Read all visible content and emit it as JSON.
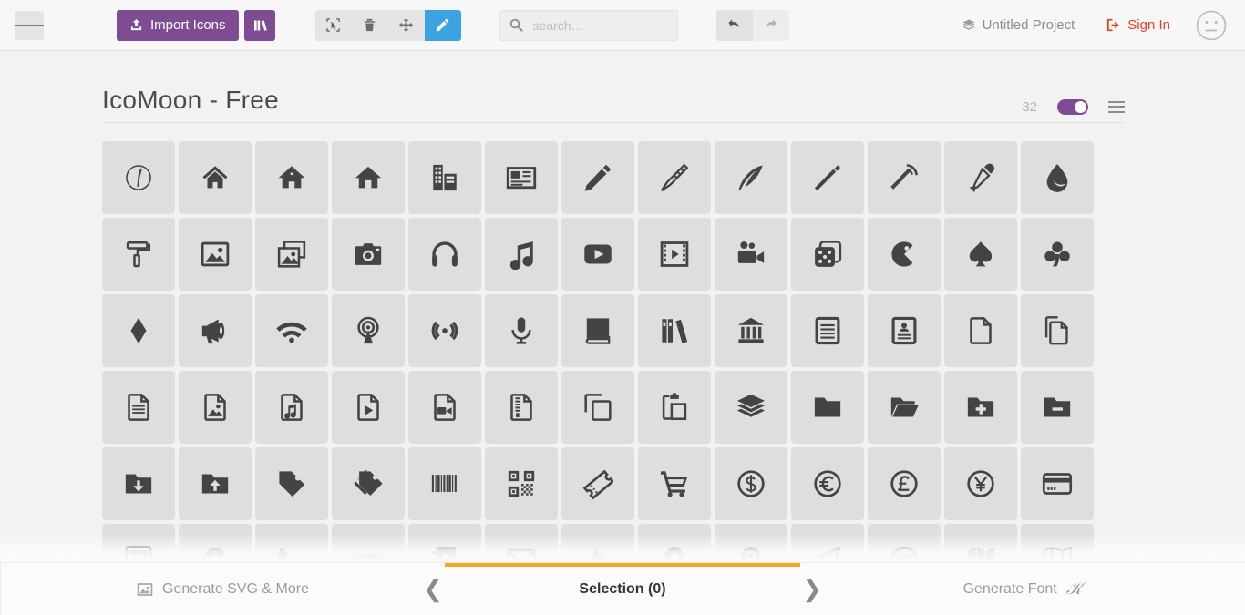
{
  "toolbar": {
    "menu_icon": "hamburger-icon",
    "import_label": "Import Icons",
    "import_icon": "upload-icon",
    "library_icon": "library-icon",
    "tools": [
      {
        "name": "select-tool",
        "icon": "cursor-select-icon",
        "active": false
      },
      {
        "name": "delete-tool",
        "icon": "trash-icon",
        "active": false
      },
      {
        "name": "move-tool",
        "icon": "move-arrows-icon",
        "active": false
      },
      {
        "name": "edit-tool",
        "icon": "pencil-icon",
        "active": true
      }
    ],
    "search": {
      "value": "",
      "placeholder": "search…",
      "icon": "search-icon"
    },
    "undo_icon": "undo-arrow-icon",
    "redo_icon": "redo-arrow-icon",
    "project_label": "Untitled Project",
    "project_icon": "layers-icon",
    "signin_label": "Sign In",
    "signin_icon": "login-icon",
    "avatar_icon": "neutral-face-icon",
    "accent_purple": "#7e4c93",
    "accent_blue": "#3ba3e0",
    "accent_red": "#e8402a"
  },
  "set": {
    "title": "IcoMoon - Free",
    "count": "32",
    "toggle_on": true,
    "toggle_color": "#7e4c93",
    "menu_icon": "set-menu-icon"
  },
  "icons": [
    {
      "name": "icomoon-logo-icon"
    },
    {
      "name": "home-outline-icon"
    },
    {
      "name": "home-2-icon"
    },
    {
      "name": "home-3-icon"
    },
    {
      "name": "office-icon"
    },
    {
      "name": "newspaper-icon"
    },
    {
      "name": "pencil-icon"
    },
    {
      "name": "pencil-2-icon"
    },
    {
      "name": "quill-icon"
    },
    {
      "name": "pen-icon"
    },
    {
      "name": "blog-icon"
    },
    {
      "name": "eyedropper-icon"
    },
    {
      "name": "droplet-icon"
    },
    {
      "name": "paint-format-icon"
    },
    {
      "name": "image-icon"
    },
    {
      "name": "images-icon"
    },
    {
      "name": "camera-icon"
    },
    {
      "name": "headphones-icon"
    },
    {
      "name": "music-icon"
    },
    {
      "name": "play-icon"
    },
    {
      "name": "film-icon"
    },
    {
      "name": "video-camera-icon"
    },
    {
      "name": "dice-icon"
    },
    {
      "name": "pacman-icon"
    },
    {
      "name": "spades-icon"
    },
    {
      "name": "clubs-icon"
    },
    {
      "name": "diamonds-icon"
    },
    {
      "name": "bullhorn-icon"
    },
    {
      "name": "connection-icon"
    },
    {
      "name": "podcast-icon"
    },
    {
      "name": "feed-icon"
    },
    {
      "name": "mic-icon"
    },
    {
      "name": "book-icon"
    },
    {
      "name": "books-icon"
    },
    {
      "name": "library-icon"
    },
    {
      "name": "file-text-icon"
    },
    {
      "name": "profile-icon"
    },
    {
      "name": "file-empty-icon"
    },
    {
      "name": "files-empty-icon"
    },
    {
      "name": "file-text2-icon"
    },
    {
      "name": "file-picture-icon"
    },
    {
      "name": "file-music-icon"
    },
    {
      "name": "file-play-icon"
    },
    {
      "name": "file-video-icon"
    },
    {
      "name": "file-zip-icon"
    },
    {
      "name": "copy-icon"
    },
    {
      "name": "paste-icon"
    },
    {
      "name": "stack-icon"
    },
    {
      "name": "folder-icon"
    },
    {
      "name": "folder-open-icon"
    },
    {
      "name": "folder-plus-icon"
    },
    {
      "name": "folder-minus-icon"
    },
    {
      "name": "folder-download-icon"
    },
    {
      "name": "folder-upload-icon"
    },
    {
      "name": "price-tag-icon"
    },
    {
      "name": "price-tags-icon"
    },
    {
      "name": "barcode-icon"
    },
    {
      "name": "qrcode-icon"
    },
    {
      "name": "ticket-icon"
    },
    {
      "name": "cart-icon"
    },
    {
      "name": "coin-dollar-icon"
    },
    {
      "name": "coin-euro-icon"
    },
    {
      "name": "coin-pound-icon"
    },
    {
      "name": "coin-yen-icon"
    },
    {
      "name": "credit-card-icon"
    },
    {
      "name": "calculator-icon"
    },
    {
      "name": "lifebuoy-icon"
    },
    {
      "name": "phone-icon"
    },
    {
      "name": "phone-hang-up-icon"
    },
    {
      "name": "address-book-icon"
    },
    {
      "name": "envelop-icon"
    },
    {
      "name": "pushpin-icon"
    },
    {
      "name": "location-icon"
    },
    {
      "name": "location2-icon"
    },
    {
      "name": "compass-icon"
    },
    {
      "name": "compass2-icon"
    },
    {
      "name": "map-icon"
    },
    {
      "name": "map2-icon"
    }
  ],
  "bottom": {
    "left_label": "Generate SVG & More",
    "left_icon": "image-icon",
    "center_label": "Selection (0)",
    "right_label": "Generate Font",
    "right_icon": "font-f-icon",
    "progress_color": "#f5a623",
    "prev_chevron": "❮",
    "next_chevron": "❯"
  }
}
